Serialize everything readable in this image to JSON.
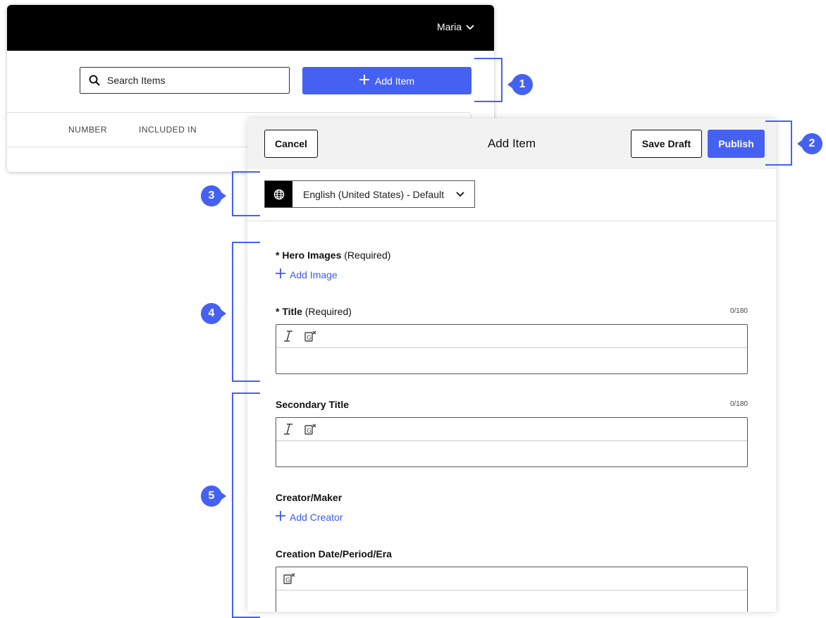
{
  "header": {
    "user_name": "Maria"
  },
  "toolbar": {
    "search_placeholder": "Search Items",
    "add_item_label": "Add Item"
  },
  "table": {
    "columns": [
      "NUMBER",
      "INCLUDED IN"
    ]
  },
  "panel": {
    "title": "Add Item",
    "cancel_label": "Cancel",
    "save_draft_label": "Save Draft",
    "publish_label": "Publish",
    "language": "English (United States) - Default"
  },
  "fields": {
    "hero_images": {
      "label": "* Hero Images",
      "required": "(Required)",
      "add_label": "Add Image"
    },
    "title": {
      "label": "* Title",
      "required": "(Required)",
      "counter": "0/180"
    },
    "secondary_title": {
      "label": "Secondary Title",
      "counter": "0/180"
    },
    "creator": {
      "label": "Creator/Maker",
      "add_label": "Add Creator"
    },
    "creation_date": {
      "label": "Creation Date/Period/Era"
    }
  },
  "callouts": [
    "1",
    "2",
    "3",
    "4",
    "5"
  ],
  "colors": {
    "accent": "#4561f2",
    "link": "#3b5ae8",
    "topbar": "#000000"
  }
}
